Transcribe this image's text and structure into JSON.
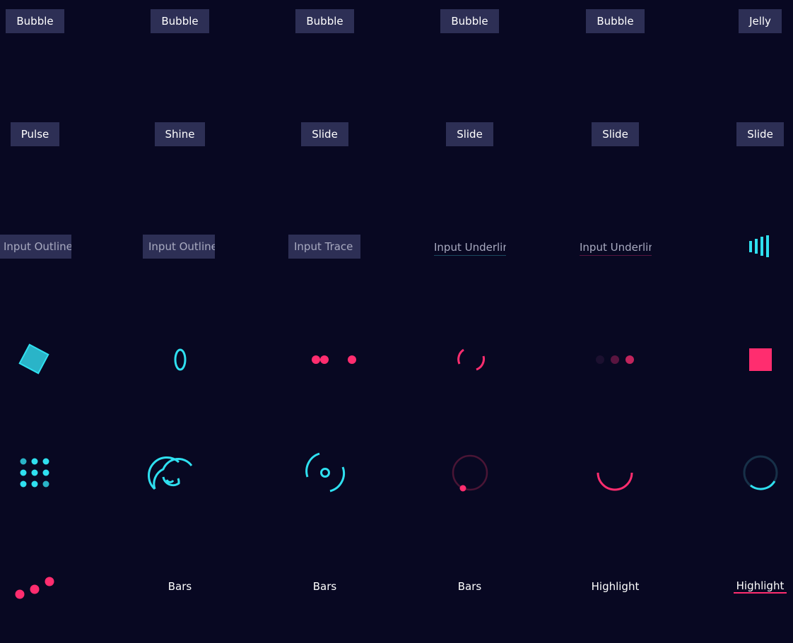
{
  "row1": [
    "Bubble",
    "Bubble",
    "Bubble",
    "Bubble",
    "Bubble",
    "Jelly"
  ],
  "row2": [
    "Pulse",
    "Shine",
    "Slide",
    "Slide",
    "Slide",
    "Slide"
  ],
  "row3": {
    "inputs": [
      "Input Outline",
      "Input Outline",
      "Input Trace"
    ],
    "underlines": [
      "Input Underline",
      "Input Underline"
    ]
  },
  "row6": {
    "labels": [
      "Bars",
      "Bars",
      "Bars",
      "Highlight",
      "Highlight"
    ]
  },
  "colors": {
    "background": "#080822",
    "button": "#2d2f55",
    "cyan": "#2fe0f0",
    "pink": "#ff2d6f"
  }
}
